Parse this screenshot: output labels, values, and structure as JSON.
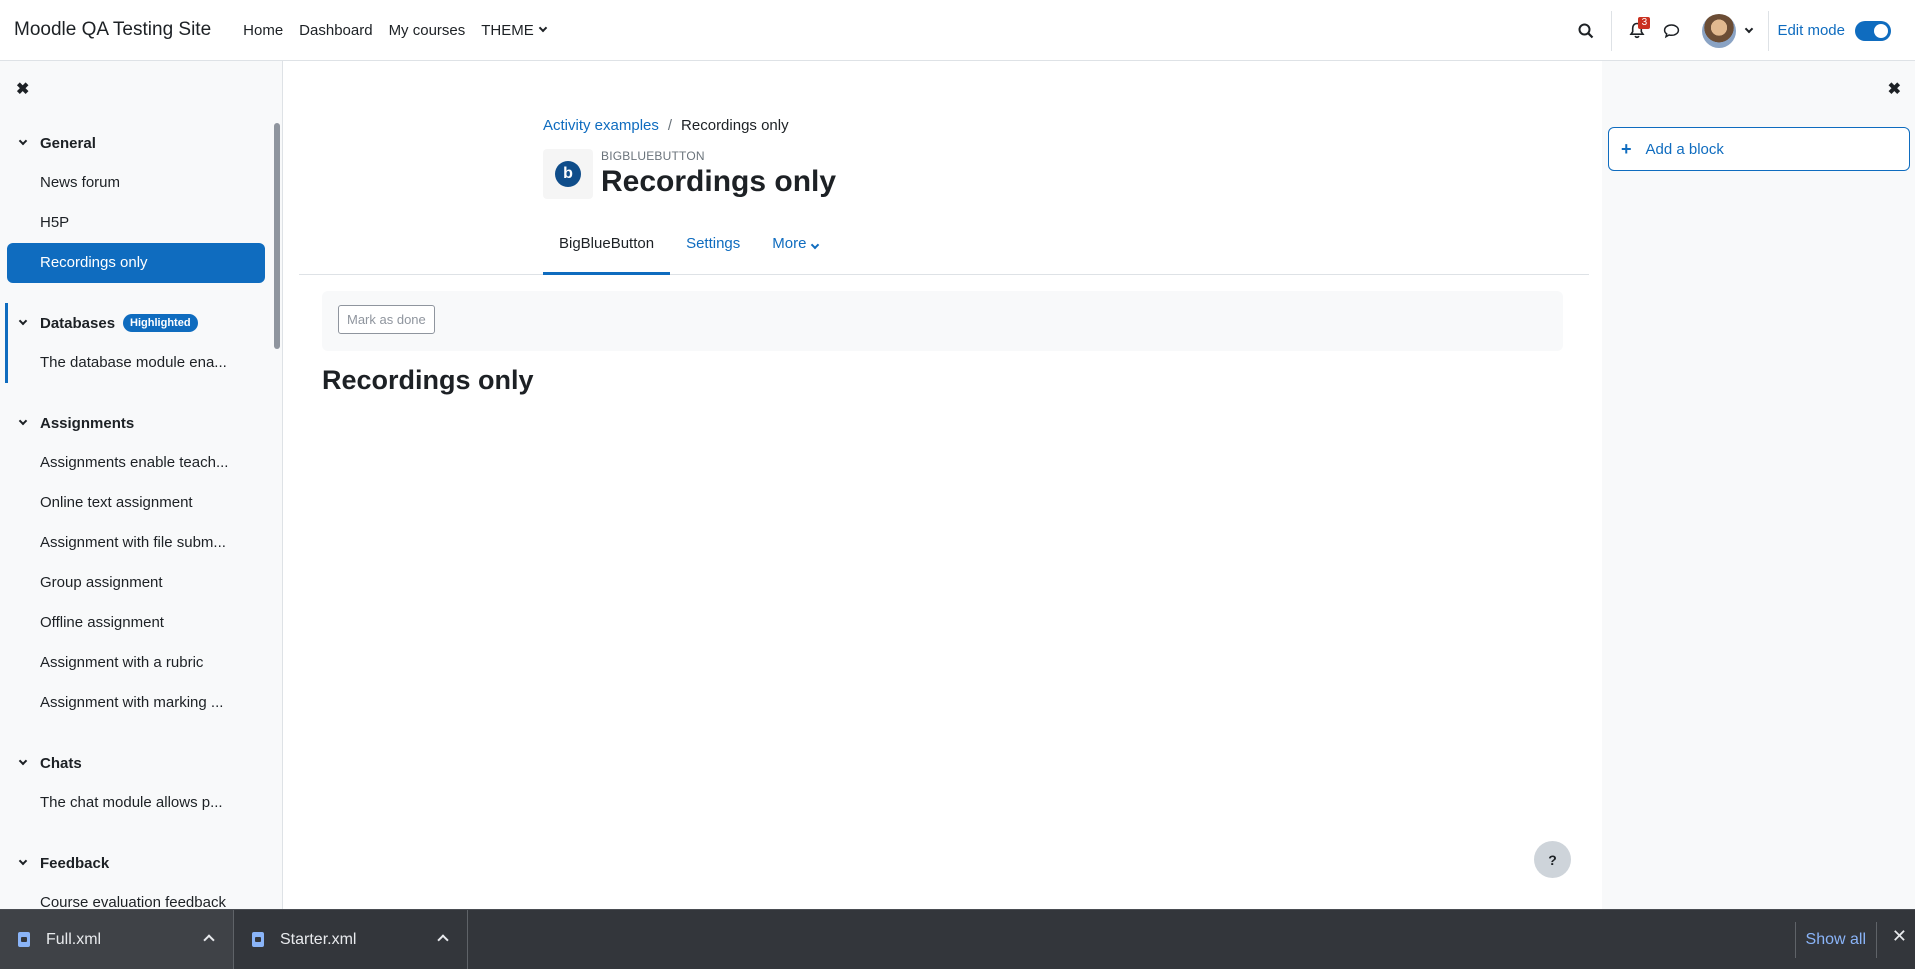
{
  "navbar": {
    "brand": "Moodle QA Testing Site",
    "links": [
      "Home",
      "Dashboard",
      "My courses",
      "THEME"
    ],
    "notification_count": "3",
    "edit_mode_label": "Edit mode"
  },
  "course_index": {
    "sections": [
      {
        "title": "General",
        "items": [
          "News forum",
          "H5P",
          "Recordings only"
        ]
      },
      {
        "title": "Databases",
        "badge": "Highlighted",
        "items": [
          "The database module ena..."
        ]
      },
      {
        "title": "Assignments",
        "items": [
          "Assignments enable teach...",
          "Online text assignment",
          "Assignment with file subm...",
          "Group assignment",
          "Offline assignment",
          "Assignment with a rubric",
          "Assignment with marking ..."
        ]
      },
      {
        "title": "Chats",
        "items": [
          "The chat module allows p..."
        ]
      },
      {
        "title": "Feedback",
        "items": [
          "Course evaluation feedback"
        ]
      }
    ],
    "active_item": "Recordings only"
  },
  "breadcrumb": {
    "parent": "Activity examples",
    "current": "Recordings only"
  },
  "header": {
    "module_type": "BIGBLUEBUTTON",
    "title": "Recordings only"
  },
  "secondary_nav": {
    "tabs": [
      "BigBlueButton",
      "Settings",
      "More"
    ],
    "active": "BigBlueButton"
  },
  "activity": {
    "mark_done_label": "Mark as done",
    "heading": "Recordings only"
  },
  "help_button": "?",
  "right_drawer": {
    "add_block_label": "Add a block"
  },
  "downloads": {
    "files": [
      "Full.xml",
      "Starter.xml"
    ],
    "show_all_label": "Show all"
  },
  "colors": {
    "primary": "#0f6cbf",
    "downloads_bg": "#33363b"
  }
}
